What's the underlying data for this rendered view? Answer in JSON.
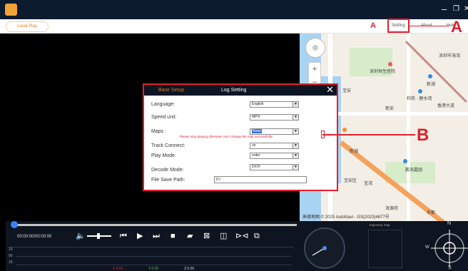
{
  "titlebar": {
    "minimize": "–",
    "restore": "❐",
    "close": "✕"
  },
  "menubar": {
    "local_play": "Local Play",
    "setting": "Setting",
    "about": "About",
    "help": "Help"
  },
  "annotations": {
    "a_small": "A",
    "a_large": "A",
    "b": "B"
  },
  "dialog": {
    "tabs": {
      "base_setup": "Base Setup",
      "log_setting": "Log Setting"
    },
    "close": "✕",
    "fields": {
      "language": {
        "label": "Language:",
        "value": "English"
      },
      "speed_unit": {
        "label": "Speed unit:",
        "value": "MPH"
      },
      "maps": {
        "label": "Maps :",
        "value": "None"
      },
      "warning": "Please stop playing,otherwise can't change the map successfully!",
      "track_connect": {
        "label": "Track Connect:",
        "value": "on"
      },
      "play_mode": {
        "label": "Play Mode",
        "value": "order"
      },
      "decode_mode": {
        "label": "Decode Mode:",
        "value": "DXVI"
      },
      "file_save_path": {
        "label": "File Save Path:",
        "value": "D:\\"
      }
    }
  },
  "map": {
    "labels": {
      "l1": "深圳市海湾",
      "l2": "深圳恒生医院",
      "l3": "新湖",
      "l4": "和苑 · 碧水湾",
      "l5": "香港大道",
      "l6": "宝安",
      "l7": "新安",
      "l8": "新湖",
      "l9": "鹏海嘉园",
      "l10": "宝湾",
      "l11": "新安",
      "l12": "宝安区",
      "l13": "名都",
      "l14": "海源苑"
    },
    "copyright": "高德地图  © 2025 AutoNavi - GS(2023)4677号",
    "zoom_in": "+",
    "zoom_out": "–"
  },
  "player": {
    "time": "00:00:00/00:00:00",
    "speed_ticks": [
      "10",
      "00",
      "10"
    ],
    "speed_xlabels": [
      "X:0.00",
      "Y:0.00",
      "Z:0.00"
    ]
  },
  "gauge": {
    "trajectory_label": "trajectory map",
    "north": "N",
    "south": "S",
    "west": "W"
  },
  "colors": {
    "accent": "#e0202d",
    "progress": "#3a82f6",
    "titlebar": "#0d1b2e",
    "orange": "#e4781f"
  }
}
